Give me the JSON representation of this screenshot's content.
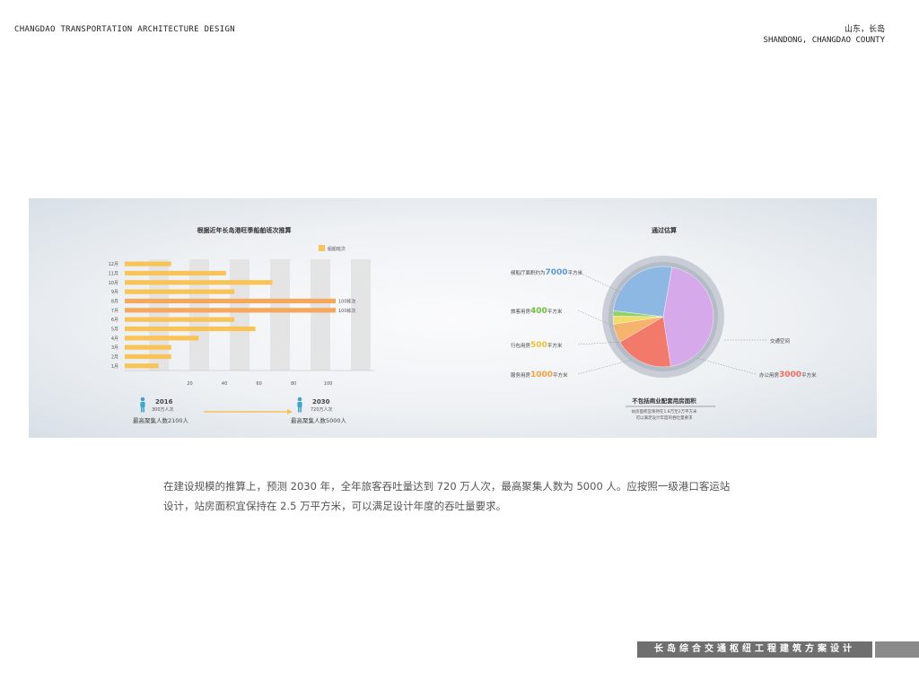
{
  "header": {
    "left_title": "CHANGDAO TRANSPORTATION ARCHITECTURE DESIGN",
    "right_line1": "山东，长岛",
    "right_line2": "SHANDONG, CHANGDAO COUNTY"
  },
  "chart_data": [
    {
      "type": "bar",
      "title": "根据近年长岛港旺季船舶班次推算",
      "legend": [
        "船舶班次"
      ],
      "legend_placement": "top-right",
      "categories": [
        "1月",
        "2月",
        "3月",
        "4月",
        "5月",
        "6月",
        "7月",
        "8月",
        "9月",
        "10月",
        "11月",
        "12月"
      ],
      "values": [
        16,
        22,
        22,
        35,
        62,
        52,
        100,
        100,
        52,
        70,
        48,
        22
      ],
      "data_labels": {
        "7月": "100栋次",
        "8月": "100栋次"
      },
      "xticks": [
        "20",
        "40",
        "60",
        "80",
        "100"
      ],
      "xlim": [
        0,
        120
      ],
      "grid": true,
      "colors": {
        "normal": "#f9c356",
        "peak": "#f5a85a"
      },
      "annotations": {
        "from_year": "2016",
        "from_volume": "300万人次",
        "from_peak": "最高聚集人数2100人",
        "to_year": "2030",
        "to_volume": "720万人次",
        "to_peak": "最高聚集人数5000人"
      }
    },
    {
      "type": "pie",
      "title": "通过估算",
      "slices": [
        {
          "label": "交通空间",
          "value": 52,
          "color": "#d6a9ea"
        },
        {
          "label_prefix": "办公用房",
          "label_value": "3000",
          "label_suffix": "平方米",
          "value": 22,
          "color": "#f27a6a"
        },
        {
          "label_prefix": "服务用房",
          "label_value": "1000",
          "label_suffix": "平方米",
          "value": 7,
          "color": "#f6b36b"
        },
        {
          "label_prefix": "行包用房",
          "label_value": "500",
          "label_suffix": "平方米",
          "value": 3,
          "color": "#f2dc6a"
        },
        {
          "label_prefix": "旅客用房",
          "label_value": "400",
          "label_suffix": "平方米",
          "value": 2,
          "color": "#8fd36a"
        },
        {
          "label_prefix": "候船厅面积约为",
          "label_value": "7000",
          "label_suffix": "平方米",
          "value": 30,
          "color": "#8eb8e4"
        }
      ],
      "note_title": "不包括商业配套用房面积",
      "note_line1": "站房面积宜保持在1.8万至2万平方米",
      "note_line2": "可以满足设计年度的吞吐量要求"
    }
  ],
  "caption": {
    "line1": "在建设规模的推算上，预测 2030 年，全年旅客吞吐量达到 720 万人次，最高聚集人数为 5000 人。应按照一级港口客运站",
    "line2": "设计，站房面积宜保持在 2.5 万平方米，可以满足设计年度的吞吐量要求。"
  },
  "footer": {
    "title": "长岛综合交通枢纽工程建筑方案设计"
  }
}
